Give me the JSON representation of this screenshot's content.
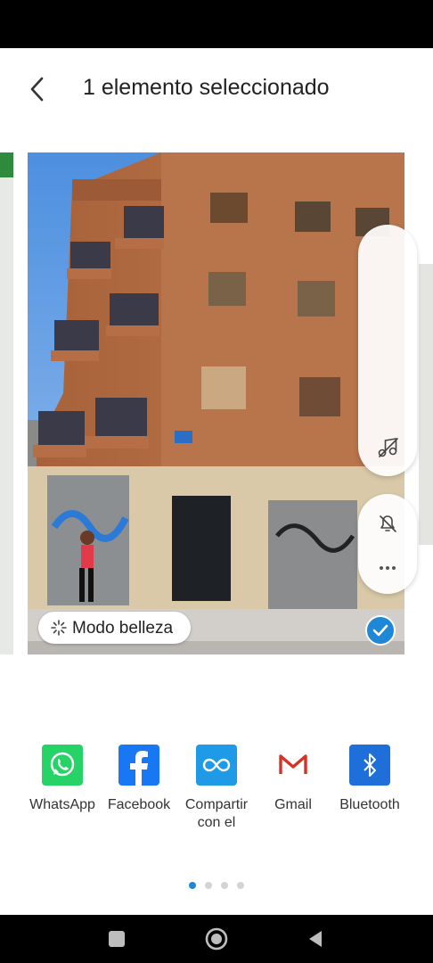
{
  "header": {
    "title": "1 elemento seleccionado",
    "back_icon": "chevron-left-icon"
  },
  "photo": {
    "beauty_label": "Modo belleza",
    "selected": true
  },
  "floating_controls": [
    "music-off-icon",
    "notification-off-icon",
    "more-icon"
  ],
  "share": {
    "apps": [
      {
        "label": "WhatsApp",
        "icon": "whatsapp-icon",
        "color": "#25d366"
      },
      {
        "label": "Facebook",
        "icon": "facebook-icon",
        "color": "#1877f2"
      },
      {
        "label": "Compartir\ncon el",
        "icon": "share-link-icon",
        "color": "#1e9ae6"
      },
      {
        "label": "Gmail",
        "icon": "gmail-icon",
        "color": "#d93025"
      },
      {
        "label": "Bluetooth",
        "icon": "bluetooth-icon",
        "color": "#1e6fd9"
      }
    ],
    "page_count": 4,
    "current_page": 1
  },
  "navbar": [
    "recents-icon",
    "home-icon",
    "back-icon"
  ],
  "colors": {
    "accent": "#1e88d6"
  }
}
